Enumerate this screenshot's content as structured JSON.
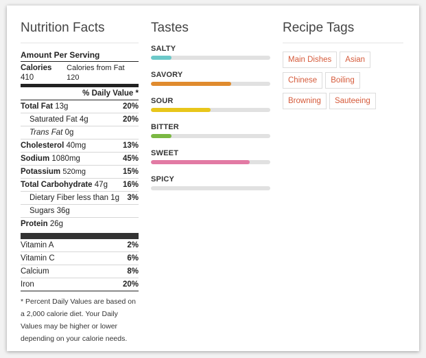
{
  "nutrition": {
    "title": "Nutrition Facts",
    "amount_per_serving": "Amount Per Serving",
    "calories_label": "Calories",
    "calories_value": "410",
    "calories_from_fat_label": "Calories from Fat",
    "calories_from_fat_value": "120",
    "dv_header": "% Daily Value *",
    "rows": [
      {
        "label": "Total Fat",
        "amount": "13g",
        "dv": "20%"
      },
      {
        "label": "Saturated Fat",
        "amount": "4g",
        "dv": "20%"
      },
      {
        "label": "Trans Fat",
        "amount": "0g",
        "dv": ""
      },
      {
        "label": "Cholesterol",
        "amount": "40mg",
        "dv": "13%"
      },
      {
        "label": "Sodium",
        "amount": "1080mg",
        "dv": "45%"
      },
      {
        "label": "Potassium",
        "amount": "520mg",
        "dv": "15%"
      },
      {
        "label": "Total Carbohydrate",
        "amount": "47g",
        "dv": "16%"
      },
      {
        "label": "Dietary Fiber",
        "amount": "less than 1g",
        "dv": "3%"
      },
      {
        "label": "Sugars",
        "amount": "36g",
        "dv": ""
      },
      {
        "label": "Protein",
        "amount": "26g",
        "dv": ""
      }
    ],
    "vitamins": [
      {
        "label": "Vitamin A",
        "dv": "2%"
      },
      {
        "label": "Vitamin C",
        "dv": "6%"
      },
      {
        "label": "Calcium",
        "dv": "8%"
      },
      {
        "label": "Iron",
        "dv": "20%"
      }
    ],
    "footnote": "* Percent Daily Values are based on a 2,000 calorie diet. Your Daily Values may be higher or lower depending on your calorie needs."
  },
  "tastes": {
    "title": "Tastes",
    "items": [
      {
        "label": "SALTY",
        "level": 0.17,
        "color": "#6cc9c9"
      },
      {
        "label": "SAVORY",
        "level": 0.67,
        "color": "#e08b2e"
      },
      {
        "label": "SOUR",
        "level": 0.5,
        "color": "#e8c61b"
      },
      {
        "label": "BITTER",
        "level": 0.17,
        "color": "#7bb843"
      },
      {
        "label": "SWEET",
        "level": 0.83,
        "color": "#e27aa4"
      },
      {
        "label": "SPICY",
        "level": 0.0,
        "color": "#e1e1e1"
      }
    ]
  },
  "tags": {
    "title": "Recipe Tags",
    "items": [
      "Main Dishes",
      "Asian",
      "Chinese",
      "Boiling",
      "Browning",
      "Sauteeing"
    ]
  }
}
